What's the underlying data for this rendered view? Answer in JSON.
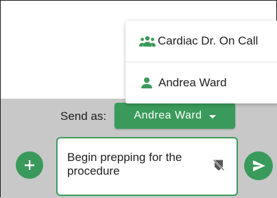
{
  "composer": {
    "send_as_label": "Send as:",
    "selected_sender": "Andrea Ward",
    "message_value": "Begin prepping for the procedure"
  },
  "sender_menu": {
    "items": [
      {
        "label": "Cardiac Dr. On Call",
        "icon": "group-icon"
      },
      {
        "label": "Andrea Ward",
        "icon": "person-icon"
      }
    ]
  },
  "icons": {
    "add": "plus-icon",
    "send": "send-icon",
    "visibility": "visibility-off-icon",
    "dropdown": "caret-down-icon"
  },
  "colors": {
    "accent": "#3a9a5b",
    "panel_background": "#c8c8c8",
    "menu_background": "#ffffff"
  }
}
